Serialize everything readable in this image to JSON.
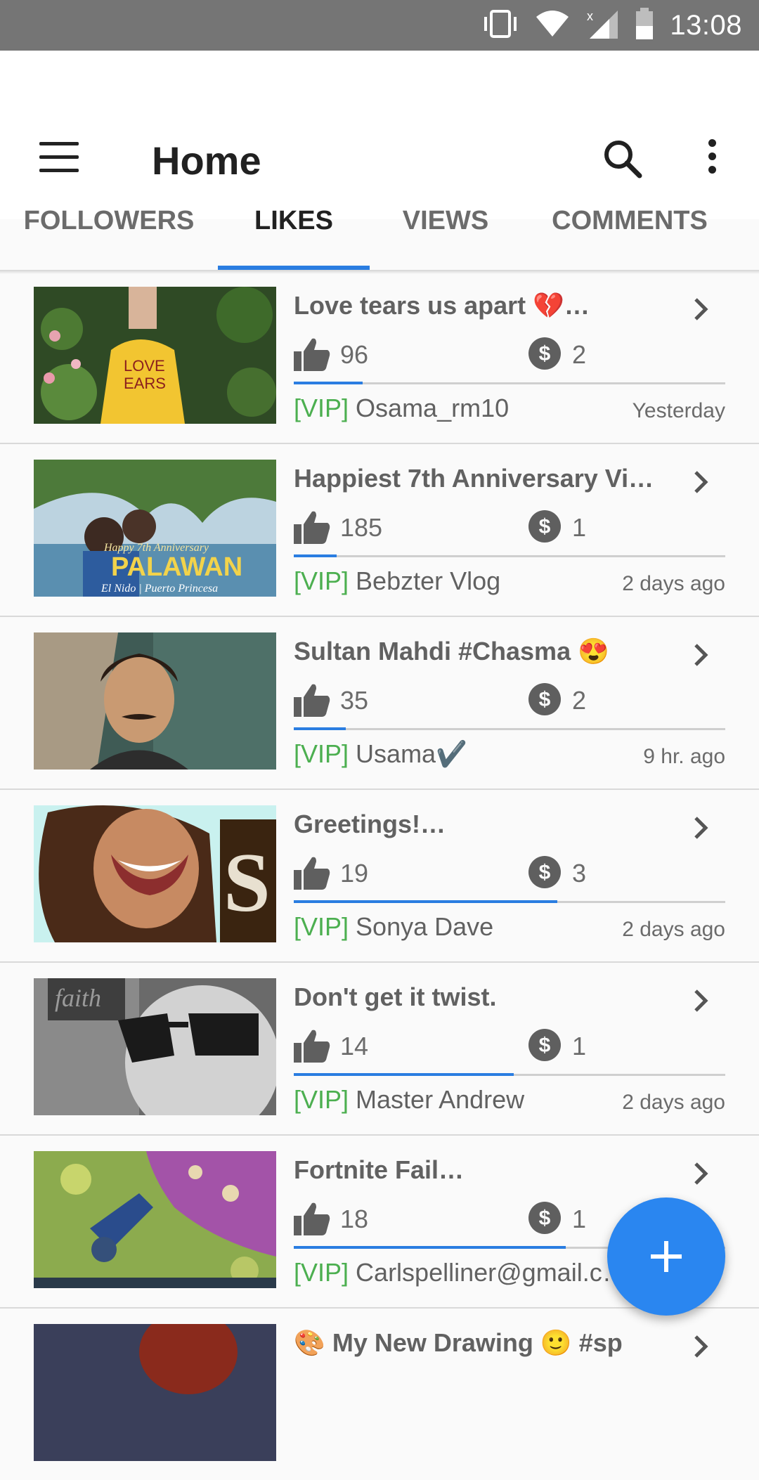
{
  "status_bar": {
    "time": "13:08",
    "icons": [
      "vibrate-icon",
      "wifi-icon",
      "signal-icon",
      "battery-icon"
    ]
  },
  "app_bar": {
    "title": "Home",
    "icons": [
      "menu-icon",
      "search-icon",
      "more-vert-icon"
    ]
  },
  "tabs": [
    {
      "label": "FOLLOWERS",
      "active": false
    },
    {
      "label": "LIKES",
      "active": true
    },
    {
      "label": "VIEWS",
      "active": false
    },
    {
      "label": "COMMENTS",
      "active": false
    }
  ],
  "colors": {
    "accent": "#2a7de1",
    "vip": "#4caf50",
    "status_bar": "#757575"
  },
  "items": [
    {
      "title": "Love tears us apart 💔…",
      "likes": "96",
      "coins": "2",
      "vip": "[VIP]",
      "author": "Osama_rm10",
      "time": "Yesterday",
      "progress": 0.16
    },
    {
      "title": "Happiest 7th Anniversary Vi…",
      "likes": "185",
      "coins": "1",
      "vip": "[VIP]",
      "author": "Bebzter Vlog",
      "time": "2 days ago",
      "progress": 0.1
    },
    {
      "title": "Sultan Mahdi #Chasma 😍",
      "likes": "35",
      "coins": "2",
      "vip": "[VIP]",
      "author": "Usama✔️",
      "time": "9 hr. ago",
      "progress": 0.12
    },
    {
      "title": "Greetings!…",
      "likes": "19",
      "coins": "3",
      "vip": "[VIP]",
      "author": "Sonya Dave",
      "time": "2 days ago",
      "progress": 0.61
    },
    {
      "title": "Don't get it twist.",
      "likes": "14",
      "coins": "1",
      "vip": "[VIP]",
      "author": "Master Andrew",
      "time": "2 days ago",
      "progress": 0.51
    },
    {
      "title": "Fortnite Fail…",
      "likes": "18",
      "coins": "1",
      "vip": "[VIP]",
      "author": "Carlspelliner@gmail.c…",
      "time": "",
      "progress": 0.63
    },
    {
      "title": "🎨 My New Drawing 🙂 #sp",
      "likes": "",
      "coins": "",
      "vip": "",
      "author": "",
      "time": "",
      "progress": 0
    }
  ],
  "fab": {
    "icon": "add-icon"
  }
}
